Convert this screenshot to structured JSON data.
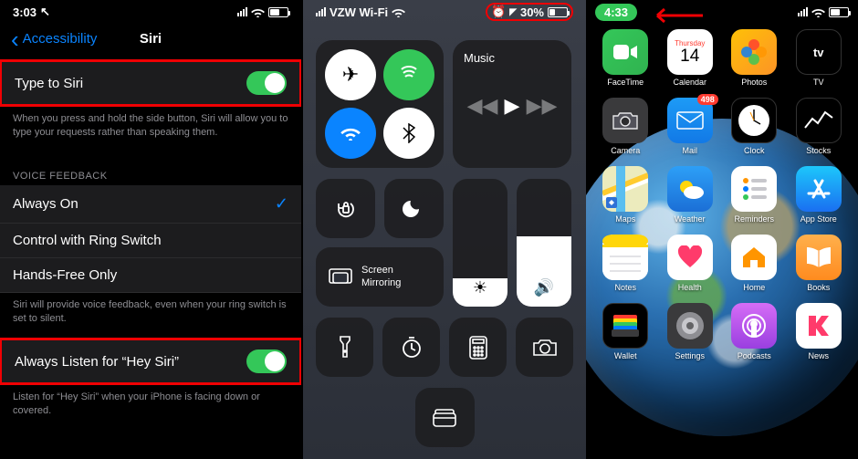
{
  "panel1": {
    "time": "3:03",
    "back_label": "Accessibility",
    "title": "Siri",
    "type_to_siri": {
      "label": "Type to Siri",
      "desc": "When you press and hold the side button, Siri will allow you to type your requests rather than speaking them."
    },
    "voice_section": "VOICE FEEDBACK",
    "options": {
      "always_on": "Always On",
      "ring_switch": "Control with Ring Switch",
      "hands_free": "Hands-Free Only"
    },
    "voice_desc": "Siri will provide voice feedback, even when your ring switch is set to silent.",
    "hey_siri": {
      "label": "Always Listen for “Hey Siri”",
      "desc": "Listen for “Hey Siri” when your iPhone is facing down or covered."
    }
  },
  "panel2": {
    "carrier": "VZW Wi-Fi",
    "battery_pct": "30%",
    "music_label": "Music",
    "screen_mirror": "Screen\nMirroring",
    "brightness": 22,
    "volume": 55
  },
  "panel3": {
    "time": "4:33",
    "calendar": {
      "day": "Thursday",
      "date": "14"
    },
    "mail_badge": "498",
    "apps": {
      "facetime": "FaceTime",
      "calendar": "Calendar",
      "photos": "Photos",
      "tv": "TV",
      "camera": "Camera",
      "mail": "Mail",
      "clock": "Clock",
      "stocks": "Stocks",
      "maps": "Maps",
      "weather": "Weather",
      "reminders": "Reminders",
      "appstore": "App Store",
      "notes": "Notes",
      "health": "Health",
      "home": "Home",
      "books": "Books",
      "wallet": "Wallet",
      "settings": "Settings",
      "podcasts": "Podcasts",
      "news": "News"
    }
  }
}
